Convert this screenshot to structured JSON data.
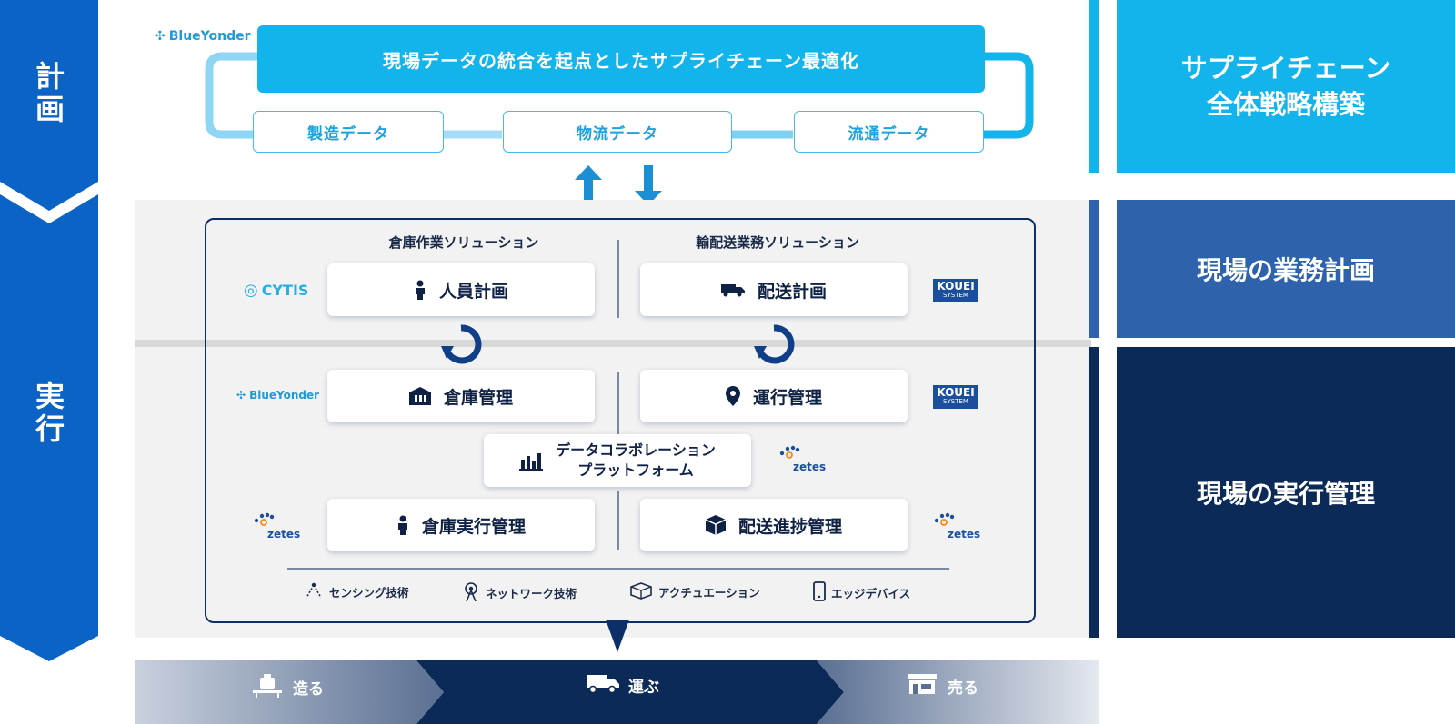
{
  "left": {
    "plan_label": "計\n画",
    "exec_label": "実\n行"
  },
  "brands": {
    "blue_yonder": "BlueYonder",
    "cytis": "CYTIS",
    "koueI": "KOUEI",
    "koueI_sub": "SYSTEM",
    "zetes": "zetes"
  },
  "top": {
    "banner": "現場データの統合を起点としたサプライチェーン最適化",
    "data_boxes": [
      "製造データ",
      "物流データ",
      "流通データ"
    ]
  },
  "solutions": {
    "warehouse_title": "倉庫作業ソリューション",
    "delivery_title": "輸配送業務ソリューション",
    "staff_plan": "人員計画",
    "delivery_plan": "配送計画",
    "warehouse_mgmt": "倉庫管理",
    "operation_mgmt": "運行管理",
    "platform_line1": "データコラボレーション",
    "platform_line2": "プラットフォーム",
    "warehouse_exec": "倉庫実行管理",
    "delivery_progress": "配送進捗管理"
  },
  "tech": [
    "センシング技術",
    "ネットワーク技術",
    "アクチュエーション",
    "エッジデバイス"
  ],
  "right": {
    "strategy_line1": "サプライチェーン",
    "strategy_line2": "全体戦略構築",
    "business_plan": "現場の業務計画",
    "exec_mgmt": "現場の実行管理"
  },
  "bottom": [
    "造る",
    "運ぶ",
    "売る"
  ],
  "colors": {
    "cyan": "#13b3ec",
    "blue": "#0b63c6",
    "mid_blue": "#2f62ad",
    "navy": "#0b2a57",
    "frame": "#0b2f66"
  }
}
